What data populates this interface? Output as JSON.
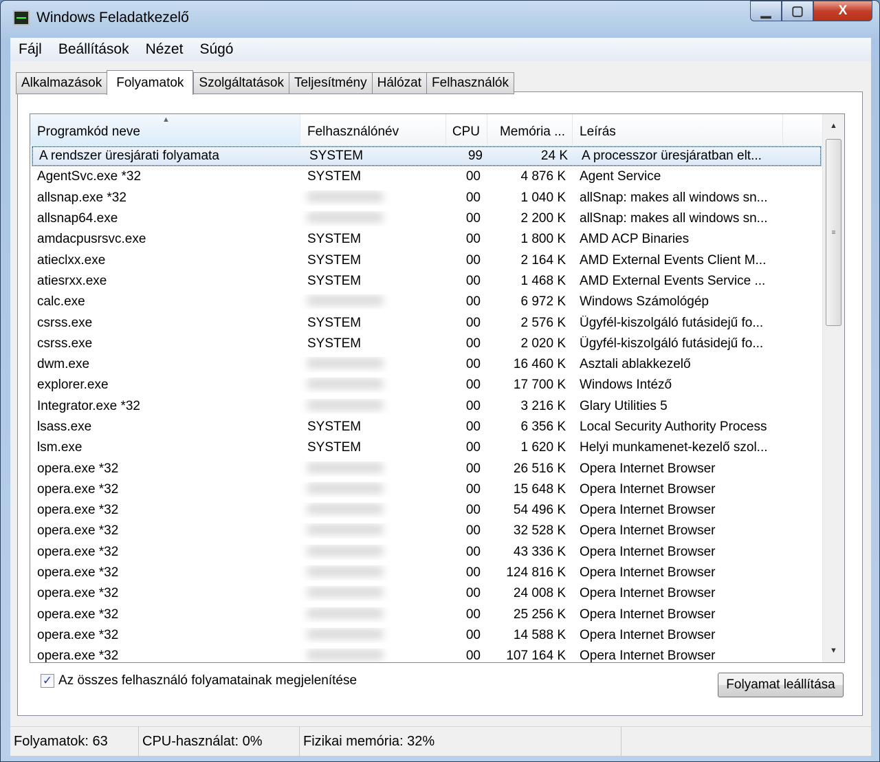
{
  "window": {
    "title": "Windows Feladatkezelő"
  },
  "menu": [
    "Fájl",
    "Beállítások",
    "Nézet",
    "Súgó"
  ],
  "tabs": [
    "Alkalmazások",
    "Folyamatok",
    "Szolgáltatások",
    "Teljesítmény",
    "Hálózat",
    "Felhasználók"
  ],
  "active_tab": "Folyamatok",
  "columns": [
    "Programkód neve",
    "Felhasználónév",
    "CPU",
    "Memória ...",
    "Leírás"
  ],
  "rows": [
    [
      "A rendszer üresjárati folyamata",
      "SYSTEM",
      "99",
      "24 K",
      "A processzor üresjáratban elt..."
    ],
    [
      "AgentSvc.exe *32",
      "SYSTEM",
      "00",
      "4 876 K",
      "Agent Service"
    ],
    [
      "allsnap.exe *32",
      "",
      "00",
      "1 040 K",
      "allSnap: makes all windows sn..."
    ],
    [
      "allsnap64.exe",
      "",
      "00",
      "2 200 K",
      "allSnap: makes all windows sn..."
    ],
    [
      "amdacpusrsvc.exe",
      "SYSTEM",
      "00",
      "1 800 K",
      "AMD ACP Binaries"
    ],
    [
      "atieclxx.exe",
      "SYSTEM",
      "00",
      "2 164 K",
      "AMD External Events Client M..."
    ],
    [
      "atiesrxx.exe",
      "SYSTEM",
      "00",
      "1 468 K",
      "AMD External Events Service ..."
    ],
    [
      "calc.exe",
      "",
      "00",
      "6 972 K",
      "Windows Számológép"
    ],
    [
      "csrss.exe",
      "SYSTEM",
      "00",
      "2 576 K",
      "Ügyfél-kiszolgáló futásidejű fo..."
    ],
    [
      "csrss.exe",
      "SYSTEM",
      "00",
      "2 020 K",
      "Ügyfél-kiszolgáló futásidejű fo..."
    ],
    [
      "dwm.exe",
      "",
      "00",
      "16 460 K",
      "Asztali ablakkezelő"
    ],
    [
      "explorer.exe",
      "",
      "00",
      "17 700 K",
      "Windows Intéző"
    ],
    [
      "Integrator.exe *32",
      "",
      "00",
      "3 216 K",
      "Glary Utilities 5"
    ],
    [
      "lsass.exe",
      "SYSTEM",
      "00",
      "6 356 K",
      "Local Security Authority Process"
    ],
    [
      "lsm.exe",
      "SYSTEM",
      "00",
      "1 620 K",
      "Helyi munkamenet-kezelő szol..."
    ],
    [
      "opera.exe *32",
      "",
      "00",
      "26 516 K",
      "Opera Internet Browser"
    ],
    [
      "opera.exe *32",
      "",
      "00",
      "15 648 K",
      "Opera Internet Browser"
    ],
    [
      "opera.exe *32",
      "",
      "00",
      "54 496 K",
      "Opera Internet Browser"
    ],
    [
      "opera.exe *32",
      "",
      "00",
      "32 528 K",
      "Opera Internet Browser"
    ],
    [
      "opera.exe *32",
      "",
      "00",
      "43 336 K",
      "Opera Internet Browser"
    ],
    [
      "opera.exe *32",
      "",
      "00",
      "124 816 K",
      "Opera Internet Browser"
    ],
    [
      "opera.exe *32",
      "",
      "00",
      "24 008 K",
      "Opera Internet Browser"
    ],
    [
      "opera.exe *32",
      "",
      "00",
      "25 256 K",
      "Opera Internet Browser"
    ],
    [
      "opera.exe *32",
      "",
      "00",
      "14 588 K",
      "Opera Internet Browser"
    ],
    [
      "opera.exe *32",
      "",
      "00",
      "107 164 K",
      "Opera Internet Browser"
    ]
  ],
  "show_all_checkbox": {
    "label": "Az összes felhasználó folyamatainak megjelenítése",
    "checked": true
  },
  "end_process_button": "Folyamat leállítása",
  "status": {
    "processes": "Folyamatok: 63",
    "cpu": "CPU-használat: 0%",
    "memory": "Fizikai memória: 32%"
  }
}
